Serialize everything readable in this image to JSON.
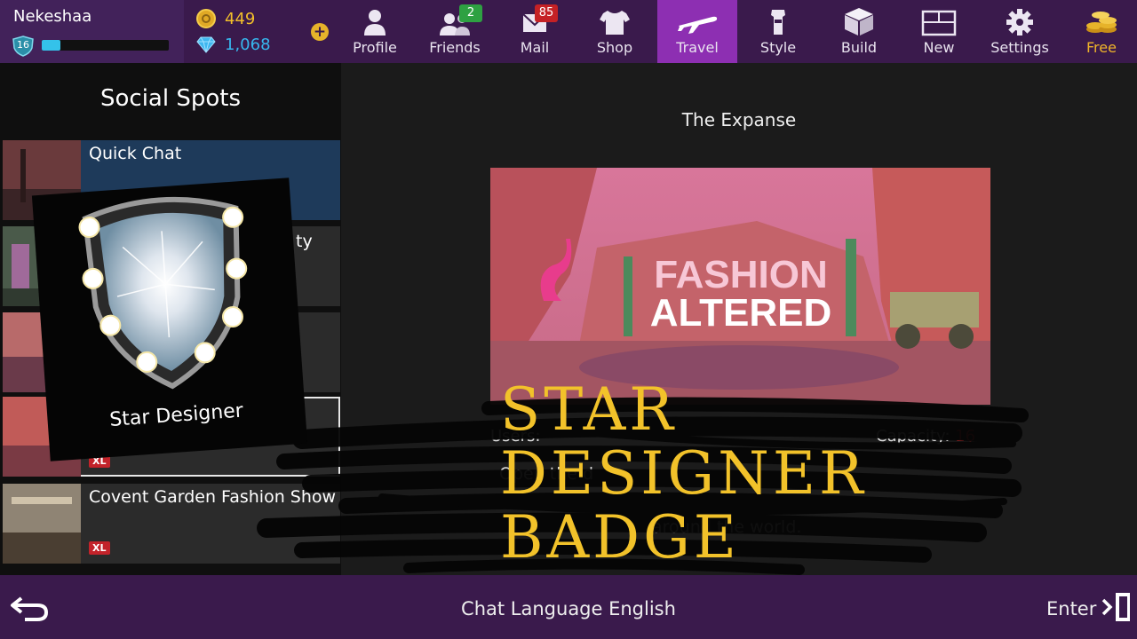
{
  "user": {
    "name": "Nekeshaa",
    "level": "16",
    "xp_fraction": 0.15
  },
  "currency": {
    "coins": "449",
    "gems": "1,068",
    "add": "+"
  },
  "nav": {
    "profile": {
      "label": "Profile",
      "icon": "profile-icon"
    },
    "friends": {
      "label": "Friends",
      "badge": "2",
      "icon": "friends-icon"
    },
    "mail": {
      "label": "Mail",
      "badge": "85",
      "icon": "mail-icon"
    },
    "shop": {
      "label": "Shop",
      "icon": "shirt-icon"
    },
    "travel": {
      "label": "Travel",
      "icon": "airplane-icon",
      "active": true
    },
    "style": {
      "label": "Style",
      "icon": "style-icon"
    },
    "build": {
      "label": "Build",
      "icon": "cube-icon"
    },
    "new": {
      "label": "New",
      "icon": "window-icon"
    },
    "settings": {
      "label": "Settings",
      "icon": "gear-icon"
    },
    "free": {
      "label": "Free",
      "icon": "coin-stack-icon"
    }
  },
  "spots": {
    "title": "Social Spots",
    "items": [
      {
        "name": "Quick Chat",
        "badge": ""
      },
      {
        "name": "ty",
        "badge": ""
      },
      {
        "name": "",
        "badge": ""
      },
      {
        "name": "",
        "badge": "XL"
      },
      {
        "name": "Covent Garden Fashion Show",
        "badge": "XL"
      }
    ]
  },
  "detail": {
    "location": "The Expanse",
    "promo_line1": "FASHION",
    "promo_line2": "ALTERED",
    "users_label": "Users:",
    "capacity_label": "Capacity:",
    "capacity_value": "16",
    "desc_line1": "Open the d",
    "desc_line2": "around the world."
  },
  "badge_card": {
    "label": "Star Designer"
  },
  "overlay": {
    "line1": "STAR",
    "line2": "DESIGNER",
    "line3": "BADGE"
  },
  "bottom": {
    "chat_language": "Chat Language  English",
    "enter": "Enter"
  },
  "colors": {
    "topbar": "#3a1a4c",
    "active_tab": "#8d2fb2",
    "overlay_text": "#f2c22a",
    "xl_badge": "#c3232a",
    "xp_bar": "#34c2ea"
  }
}
